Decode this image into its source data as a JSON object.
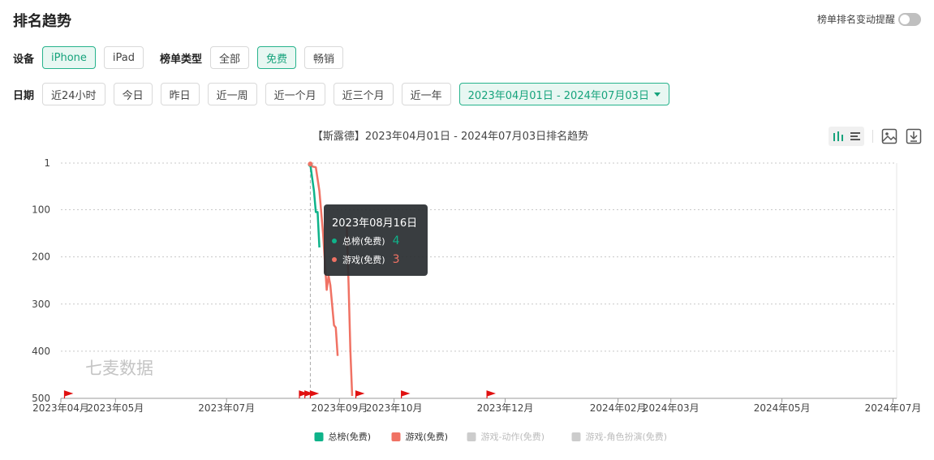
{
  "header": {
    "title": "排名趋势",
    "remind_label": "榜单排名变动提醒"
  },
  "device": {
    "label": "设备",
    "options": [
      "iPhone",
      "iPad"
    ],
    "selected": "iPhone"
  },
  "list_type": {
    "label": "榜单类型",
    "options": [
      "全部",
      "免费",
      "畅销"
    ],
    "selected": "免费"
  },
  "date": {
    "label": "日期",
    "options": [
      "近24小时",
      "今日",
      "昨日",
      "近一周",
      "近一个月",
      "近三个月",
      "近一年"
    ],
    "range": "2023年04月01日 - 2024年07月03日"
  },
  "watermark": "七麦数据",
  "colors": {
    "accent": "#16a37c",
    "series1": "#0fb38a",
    "series2": "#f07264",
    "inactive": "#cccccc",
    "flag": "#e01010"
  },
  "tooltip": {
    "date": "2023年08月16日",
    "items": [
      {
        "name": "总榜(免费)",
        "value": "4"
      },
      {
        "name": "游戏(免费)",
        "value": "3"
      }
    ]
  },
  "chart_data": {
    "type": "line",
    "title": "【斯露德】2023年04月01日 - 2024年07月03日排名趋势",
    "y_inverted": true,
    "ylim": [
      1,
      500
    ],
    "y_ticks": [
      1,
      100,
      200,
      300,
      400,
      500
    ],
    "x_range": [
      "2023-04-01",
      "2024-07-03"
    ],
    "x_ticks": [
      {
        "date": "2023-04-01",
        "label": "2023年04月"
      },
      {
        "date": "2023-05-01",
        "label": "2023年05月"
      },
      {
        "date": "2023-07-01",
        "label": "2023年07月"
      },
      {
        "date": "2023-09-01",
        "label": "2023年09月"
      },
      {
        "date": "2023-10-01",
        "label": "2023年10月"
      },
      {
        "date": "2023-12-01",
        "label": "2023年12月"
      },
      {
        "date": "2024-02-01",
        "label": "2024年02月"
      },
      {
        "date": "2024-03-01",
        "label": "2024年03月"
      },
      {
        "date": "2024-05-01",
        "label": "2024年05月"
      },
      {
        "date": "2024-07-01",
        "label": "2024年07月"
      }
    ],
    "series": [
      {
        "name": "总榜(免费)",
        "active": true,
        "points": [
          [
            "2023-08-16",
            4
          ],
          [
            "2023-08-18",
            60
          ],
          [
            "2023-08-19",
            105
          ],
          [
            "2023-08-20",
            105
          ],
          [
            "2023-08-21",
            180
          ]
        ]
      },
      {
        "name": "游戏(免费)",
        "active": true,
        "points": [
          [
            "2023-08-16",
            3
          ],
          [
            "2023-08-17",
            8
          ],
          [
            "2023-08-19",
            10
          ],
          [
            "2023-08-21",
            60
          ],
          [
            "2023-08-23",
            150
          ],
          [
            "2023-08-25",
            270
          ],
          [
            "2023-08-26",
            240
          ],
          [
            "2023-08-27",
            260
          ],
          [
            "2023-08-29",
            345
          ],
          [
            "2023-08-30",
            350
          ],
          [
            "2023-08-31",
            410
          ]
        ]
      },
      {
        "name": "游戏(免费)",
        "active": true,
        "points": [
          [
            "2023-09-05",
            135
          ],
          [
            "2023-09-06",
            260
          ],
          [
            "2023-09-07",
            400
          ],
          [
            "2023-09-08",
            495
          ]
        ]
      },
      {
        "name": "游戏-动作(免费)",
        "active": false,
        "points": []
      },
      {
        "name": "游戏-角色扮演(免费)",
        "active": false,
        "points": []
      }
    ],
    "event_flags": [
      "2023-04-03",
      "2023-08-10",
      "2023-08-13",
      "2023-08-16",
      "2023-09-10",
      "2023-10-05",
      "2023-11-21"
    ],
    "legend": [
      "总榜(免费)",
      "游戏(免费)",
      "游戏-动作(免费)",
      "游戏-角色扮演(免费)"
    ],
    "grid": true,
    "legend_position": "bottom"
  }
}
